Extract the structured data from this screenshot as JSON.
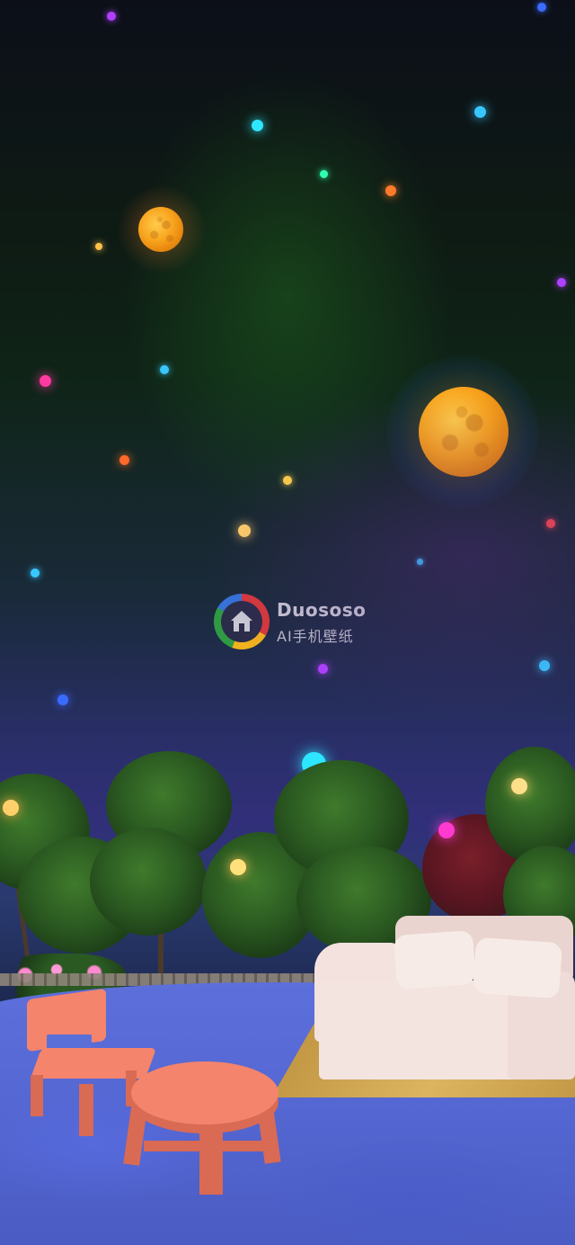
{
  "watermark": {
    "brand": "Duososo",
    "tagline": "AI手机壁纸",
    "icon": "house-icon"
  },
  "scene": {
    "moons": [
      "moon-small",
      "moon-large"
    ],
    "orb_colors": [
      "#b040ff",
      "#2ee6ff",
      "#ff7a2a",
      "#ff3aa0",
      "#ffd24a",
      "#3a6bff",
      "#38c6ff"
    ]
  }
}
